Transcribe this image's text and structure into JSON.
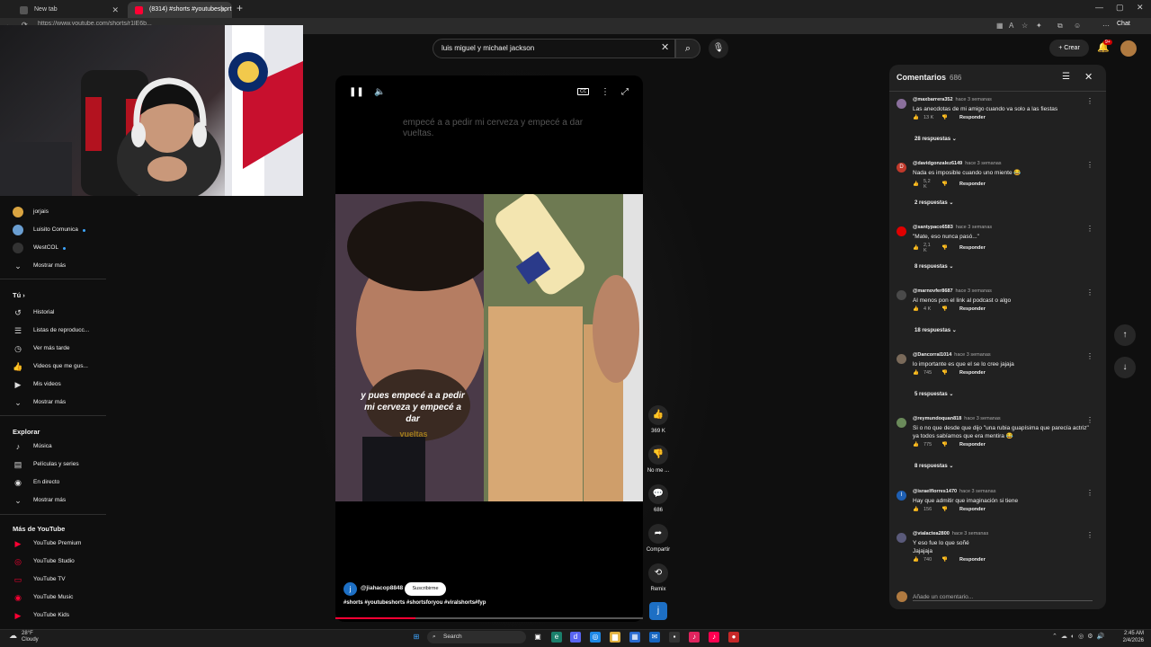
{
  "browser": {
    "tabs": [
      {
        "title": "New tab"
      },
      {
        "title": "(8314) #shorts #youtubeshort"
      }
    ],
    "new_tab_symbol": "+",
    "url": "https://www.youtube.com/shorts/r1lE6b...",
    "chat_label": "Chat"
  },
  "header": {
    "search_query": "luis miguel y michael jackson",
    "create_label": "Crear",
    "notif_count": "9+"
  },
  "sidebar": {
    "subscriptions": [
      {
        "label": "jorjais",
        "dot": false
      },
      {
        "label": "Luisito Comunica",
        "dot": true
      },
      {
        "label": "WestCOL",
        "dot": true
      }
    ],
    "show_more_1": "Mostrar más",
    "you_heading": "Tú",
    "you_items": [
      {
        "label": "Historial",
        "icon": "history-icon"
      },
      {
        "label": "Listas de reproducc...",
        "icon": "playlist-icon"
      },
      {
        "label": "Ver más tarde",
        "icon": "clock-icon"
      },
      {
        "label": "Videos que me gus...",
        "icon": "thumbs-up-icon"
      },
      {
        "label": "Mis videos",
        "icon": "video-icon"
      }
    ],
    "show_more_2": "Mostrar más",
    "explore_heading": "Explorar",
    "explore_items": [
      {
        "label": "Música",
        "icon": "music-icon"
      },
      {
        "label": "Películas y series",
        "icon": "film-icon"
      },
      {
        "label": "En directo",
        "icon": "live-icon"
      }
    ],
    "show_more_3": "Mostrar más",
    "more_heading": "Más de YouTube",
    "more_items": [
      {
        "label": "YouTube Premium"
      },
      {
        "label": "YouTube Studio"
      },
      {
        "label": "YouTube TV"
      },
      {
        "label": "YouTube Music"
      },
      {
        "label": "YouTube Kids"
      }
    ]
  },
  "short": {
    "top_text": "empecé a a pedir mi cerveza y empecé a dar vueltas.",
    "caption": "y pues empecé a a pedir mi cerveza y empecé a dar",
    "caption_dim": "vueltas",
    "channel_initial": "j",
    "channel": "@jiahacop8848",
    "subscribe_label": "Suscribirme",
    "hashtags": "#shorts #youtubeshorts #shortsforyou #viralshorts#fyp",
    "progress": 0.26,
    "actions": {
      "likes": "369 K",
      "dislike_label": "No me ...",
      "comments": "686",
      "share_label": "Compartir",
      "remix_label": "Remix"
    }
  },
  "comments_panel": {
    "title": "Comentarios",
    "count": "686",
    "items": [
      {
        "author": "@maxbarrera352",
        "time": "hace 3 semanas",
        "text": "Las anecdotas de mi amigo cuando va solo a las fiestas",
        "likes": "13 K",
        "reply": "Responder",
        "replies": "28 respuestas",
        "avatar_color": "#8a6f9c",
        "avatar_letter": ""
      },
      {
        "author": "@davidgonzalez6149",
        "time": "hace 3 semanas",
        "text": "Nada es imposible cuando uno miente 😂",
        "likes": "5,2 K",
        "reply": "Responder",
        "replies": "2 respuestas",
        "avatar_color": "#c0392b",
        "avatar_letter": "D"
      },
      {
        "author": "@santypaco6583",
        "time": "hace 3 semanas",
        "text": "\"Mate, eso nunca pasó...\"",
        "likes": "2,1 K",
        "reply": "Responder",
        "replies": "8 respuestas",
        "avatar_color": "#e00000",
        "avatar_letter": ""
      },
      {
        "author": "@marnovfer8687",
        "time": "hace 3 semanas",
        "text": "Al menos pon el link al podcast o algo",
        "likes": "4 K",
        "reply": "Responder",
        "replies": "18 respuestas",
        "avatar_color": "#4a4a4a",
        "avatar_letter": ""
      },
      {
        "author": "@Dancorral1014",
        "time": "hace 3 semanas",
        "text": "lo importante es que el se lo cree jajaja",
        "likes": "745",
        "reply": "Responder",
        "replies": "5 respuestas",
        "avatar_color": "#7a6a5a",
        "avatar_letter": ""
      },
      {
        "author": "@reymundoquan818",
        "time": "hace 3 semanas",
        "text": "Si o no que desde que dijo \"una rubia guapísima que parecía actriz\" ya todos sabíamos que era mentira 😂",
        "likes": "775",
        "reply": "Responder",
        "replies": "8 respuestas",
        "avatar_color": "#6a8a5a",
        "avatar_letter": ""
      },
      {
        "author": "@israelflorres1470",
        "time": "hace 3 semanas",
        "text": "Hay que admitir que imaginación si tiene",
        "likes": "156",
        "reply": "Responder",
        "replies": "",
        "avatar_color": "#1e5fb3",
        "avatar_letter": "I"
      },
      {
        "author": "@vialactea2800",
        "time": "hace 3 semanas",
        "text": "Y eso fue lo que soñé\nJajajaja",
        "likes": "740",
        "reply": "Responder",
        "replies": "",
        "avatar_color": "#5a5a7a",
        "avatar_letter": ""
      }
    ],
    "add_placeholder": "Añade un comentario..."
  },
  "taskbar": {
    "temp": "28°F",
    "weather": "Cloudy",
    "search_label": "Search",
    "time": "2:45 AM",
    "date": "2/4/2026"
  },
  "colors": {
    "accent_red": "#ff0033",
    "link_blue": "#3ea6ff",
    "panel_bg": "#212121"
  }
}
